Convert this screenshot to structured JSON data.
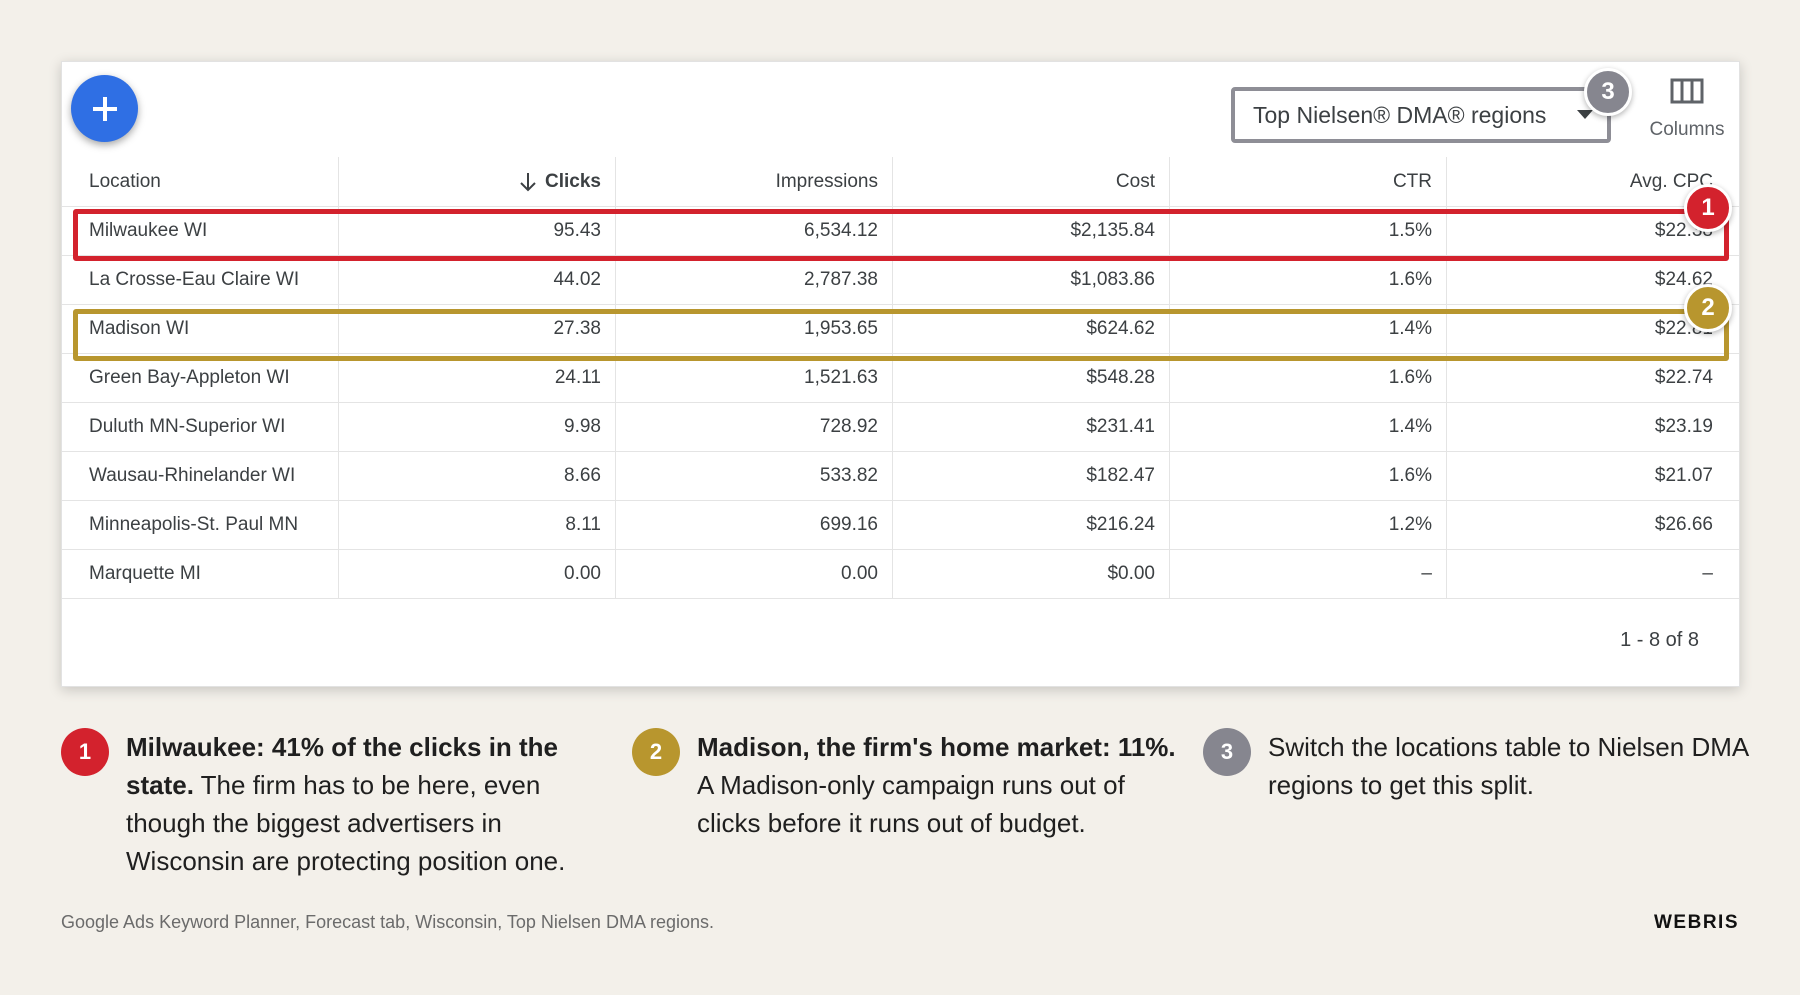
{
  "toolbar": {
    "region_select": "Top Nielsen® DMA® regions",
    "columns_label": "Columns"
  },
  "table": {
    "headers": [
      "Location",
      "Clicks",
      "Impressions",
      "Cost",
      "CTR",
      "Avg. CPC"
    ],
    "sorted_column": "Clicks",
    "rows": [
      [
        "Milwaukee WI",
        "95.43",
        "6,534.12",
        "$2,135.84",
        "1.5%",
        "$22.38"
      ],
      [
        "La Crosse-Eau Claire WI",
        "44.02",
        "2,787.38",
        "$1,083.86",
        "1.6%",
        "$24.62"
      ],
      [
        "Madison WI",
        "27.38",
        "1,953.65",
        "$624.62",
        "1.4%",
        "$22.81"
      ],
      [
        "Green Bay-Appleton WI",
        "24.11",
        "1,521.63",
        "$548.28",
        "1.6%",
        "$22.74"
      ],
      [
        "Duluth MN-Superior WI",
        "9.98",
        "728.92",
        "$231.41",
        "1.4%",
        "$23.19"
      ],
      [
        "Wausau-Rhinelander WI",
        "8.66",
        "533.82",
        "$182.47",
        "1.6%",
        "$21.07"
      ],
      [
        "Minneapolis-St. Paul MN",
        "8.11",
        "699.16",
        "$216.24",
        "1.2%",
        "$26.66"
      ],
      [
        "Marquette MI",
        "0.00",
        "0.00",
        "$0.00",
        "–",
        "–"
      ]
    ],
    "pagination": "1 - 8 of 8"
  },
  "callouts": {
    "badge1": "1",
    "badge2": "2",
    "badge3": "3"
  },
  "notes": [
    {
      "number": "1",
      "bold": "Milwaukee: 41% of the clicks in the state.",
      "text": " The firm has to be here, even though the biggest advertisers in Wisconsin are protecting position one."
    },
    {
      "number": "2",
      "bold": "Madison, the firm's home market: 11%.",
      "text": " A Madison-only campaign runs out of clicks before it runs out of budget."
    },
    {
      "number": "3",
      "bold": "",
      "text": "Switch the locations table to Nielsen DMA regions to get this split."
    }
  ],
  "footer": {
    "source": "Google Ads Keyword Planner, Forecast tab, Wisconsin, Top Nielsen DMA regions.",
    "brand": "WEBRIS"
  },
  "colors": {
    "accent_red": "#d3222d",
    "accent_gold": "#b8962e",
    "accent_gray": "#86868f",
    "fab_blue": "#2f6fe4",
    "background": "#f3f0ea"
  }
}
